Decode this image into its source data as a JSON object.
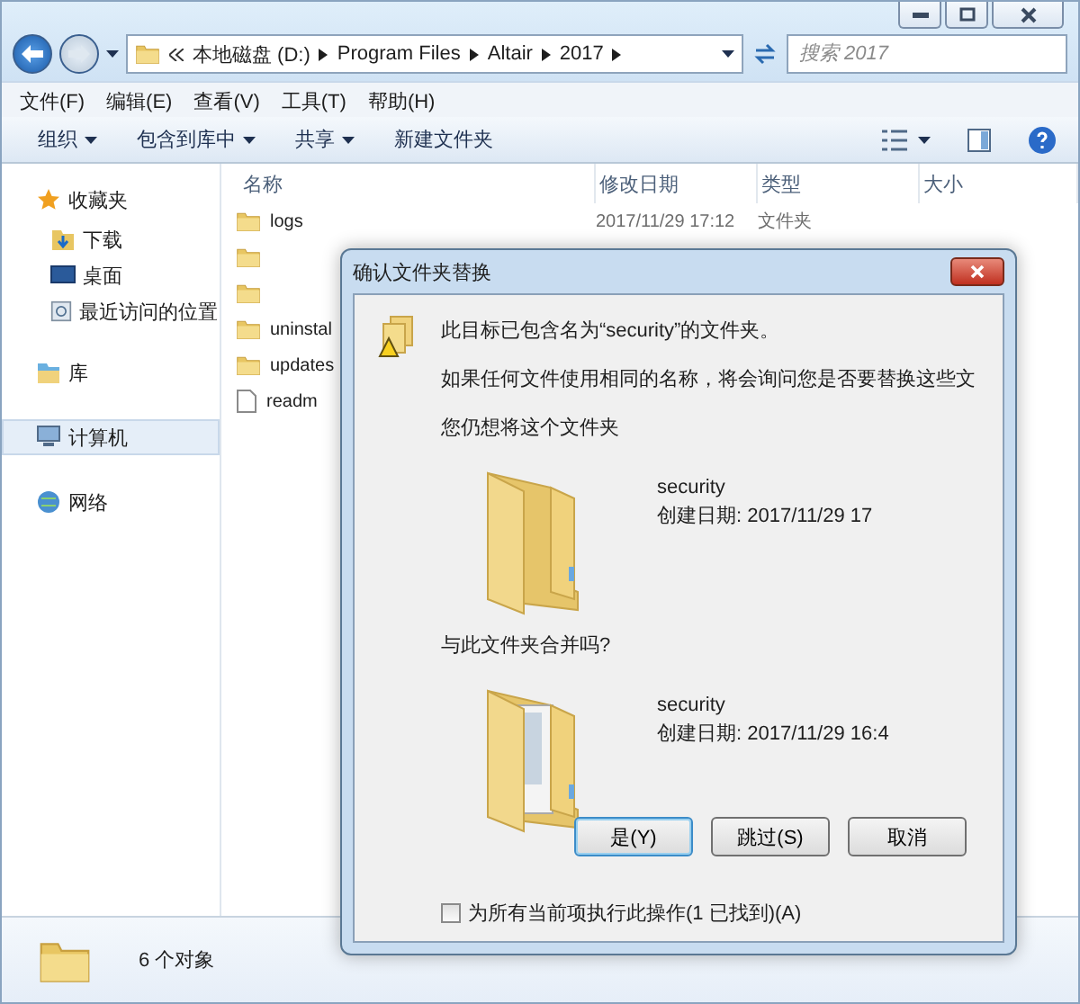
{
  "window": {
    "address": [
      "本地磁盘 (D:)",
      "Program Files",
      "Altair",
      "2017"
    ],
    "search": {
      "placeholder": "搜索 2017"
    }
  },
  "menu": [
    "文件(F)",
    "编辑(E)",
    "查看(V)",
    "工具(T)",
    "帮助(H)"
  ],
  "toolbar": [
    {
      "label": "组织",
      "dropdown": true
    },
    {
      "label": "包含到库中",
      "dropdown": true
    },
    {
      "label": "共享",
      "dropdown": true
    },
    {
      "label": "新建文件夹",
      "dropdown": false
    }
  ],
  "sidebar": [
    {
      "label": "收藏夹",
      "kind": "star",
      "selected": false,
      "children": [
        {
          "label": "下载",
          "kind": "download",
          "selected": false
        },
        {
          "label": "桌面",
          "kind": "desktop",
          "selected": false
        },
        {
          "label": "最近访问的位置",
          "kind": "recent",
          "selected": false
        }
      ]
    },
    {
      "label": "库",
      "kind": "library",
      "selected": false
    },
    {
      "label": "计算机",
      "kind": "computer",
      "selected": true
    },
    {
      "label": "网络",
      "kind": "network",
      "selected": false
    }
  ],
  "table": {
    "columns": [
      "名称",
      "修改日期",
      "类型",
      "大小"
    ],
    "rows": [
      {
        "kind": "folder",
        "name": "logs",
        "date": "2017/11/29 17:12",
        "type": "文件夹"
      },
      {
        "kind": "folder"
      },
      {
        "kind": "folder"
      },
      {
        "kind": "folder",
        "name": "uninstal"
      },
      {
        "kind": "folder",
        "name": "updates"
      },
      {
        "kind": "file",
        "name": "readm"
      }
    ]
  },
  "status_bar": {
    "count": "6 个对象"
  },
  "dialog": {
    "title": "确认文件夹替换",
    "message": "此目标已包含名为“security”的文件夹。",
    "detail": "如果任何文件使用相同的名称，将会询问您是否要替换这些文",
    "question1": "您仍想将这个文件夹",
    "source": {
      "name": "security",
      "created": "创建日期: 2017/11/29 17",
      "kind": "empty"
    },
    "question2": "与此文件夹合并吗?",
    "target": {
      "name": "security",
      "created": "创建日期: 2017/11/29 16:4",
      "kind": "full"
    },
    "buttons": [
      {
        "label": "是(Y)",
        "selected": true
      },
      {
        "label": "跳过(S)",
        "selected": false
      },
      {
        "label": "取消",
        "selected": false
      }
    ],
    "apply_all": {
      "label": "为所有当前项执行此操作(1 已找到)(A)",
      "checked": false
    }
  }
}
